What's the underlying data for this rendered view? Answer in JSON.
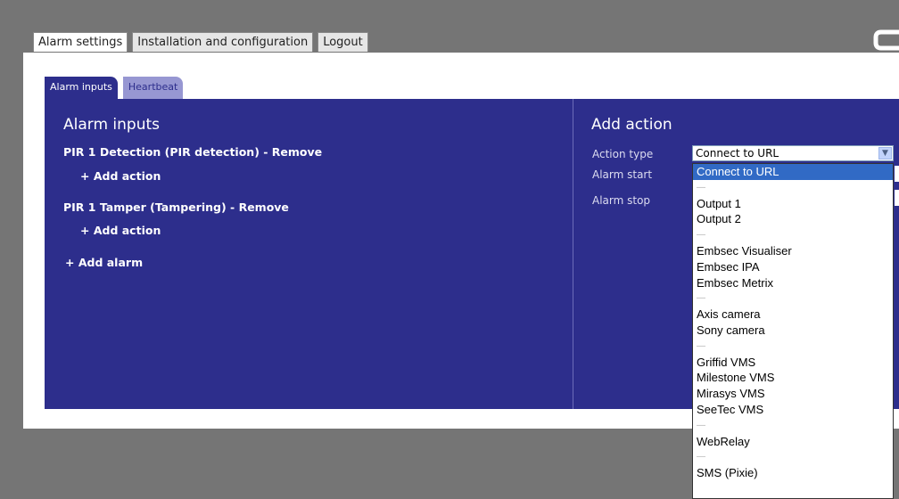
{
  "top_tabs": [
    "Alarm settings",
    "Installation and configuration",
    "Logout"
  ],
  "sub_tabs": [
    "Alarm inputs",
    "Heartbeat"
  ],
  "left": {
    "title": "Alarm inputs",
    "alarms": [
      {
        "label": "PIR 1 Detection (PIR detection) - Remove",
        "add_action": "+ Add action"
      },
      {
        "label": "PIR 1 Tamper (Tampering) - Remove",
        "add_action": "+ Add action"
      }
    ],
    "add_alarm": "+ Add alarm"
  },
  "right": {
    "title": "Add action",
    "labels": [
      "Action type",
      "Alarm start",
      "Alarm stop"
    ],
    "selected_value": "Connect to URL"
  },
  "dropdown_options": [
    "Connect to URL",
    "—",
    "Output 1",
    "Output 2",
    "—",
    "Embsec Visualiser",
    "Embsec IPA",
    "Embsec Metrix",
    "—",
    "Axis camera",
    "Sony camera",
    "—",
    "Griffid VMS",
    "Milestone VMS",
    "Mirasys VMS",
    "SeeTec VMS",
    "—",
    "WebRelay",
    "—",
    "SMS (Pixie)"
  ],
  "colors": {
    "panel_blue": "#2d2e8c",
    "tab_inactive": "#9797d2",
    "selection": "#316ac5"
  }
}
